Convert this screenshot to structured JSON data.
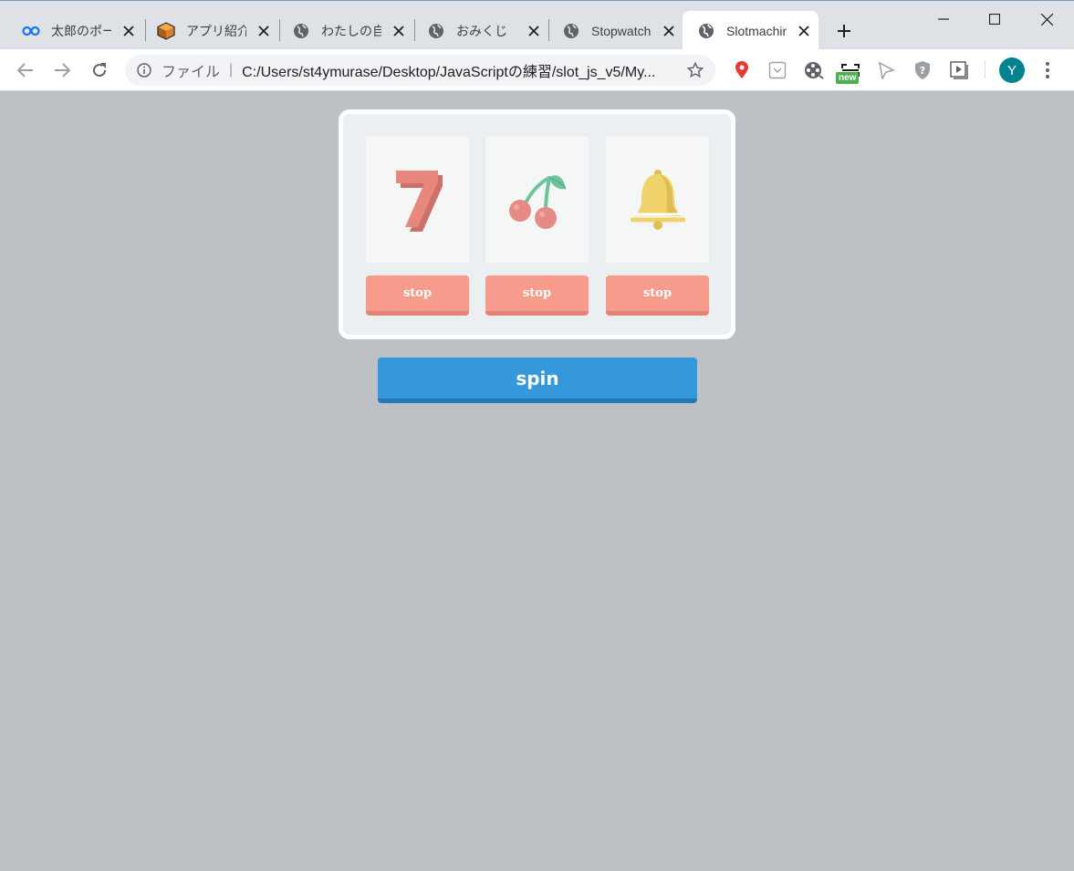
{
  "browser": {
    "tabs": [
      {
        "title": "太郎のポートフォリオ",
        "icon": "infinity-icon"
      },
      {
        "title": "アプリ紹介ページ",
        "icon": "box-icon"
      },
      {
        "title": "わたしの自己紹介",
        "icon": "globe-icon"
      },
      {
        "title": "おみくじ",
        "icon": "globe-icon"
      },
      {
        "title": "Stopwatch",
        "icon": "globe-icon"
      },
      {
        "title": "Slotmachine",
        "icon": "globe-icon",
        "active": true
      }
    ],
    "omnibox": {
      "scheme": "ファイル",
      "separator": "|",
      "url": "C:/Users/st4ymurase/Desktop/JavaScriptの練習/slot_js_v5/My..."
    },
    "extension_badge": "new",
    "avatar_letter": "Y"
  },
  "slot": {
    "reels": [
      {
        "symbol": "seven-icon"
      },
      {
        "symbol": "cherry-icon"
      },
      {
        "symbol": "bell-icon"
      }
    ],
    "stop_labels": [
      "stop",
      "stop",
      "stop"
    ],
    "spin_label": "spin"
  },
  "colors": {
    "page_bg": "#bdc1c6",
    "machine_bg": "#eceff1",
    "stop_button": "#f79c8c",
    "spin_button": "#3498db",
    "seven": "#e8877c",
    "cherry_fruit": "#e58a84",
    "cherry_leaf": "#6cc59a",
    "bell": "#f0d26a"
  }
}
